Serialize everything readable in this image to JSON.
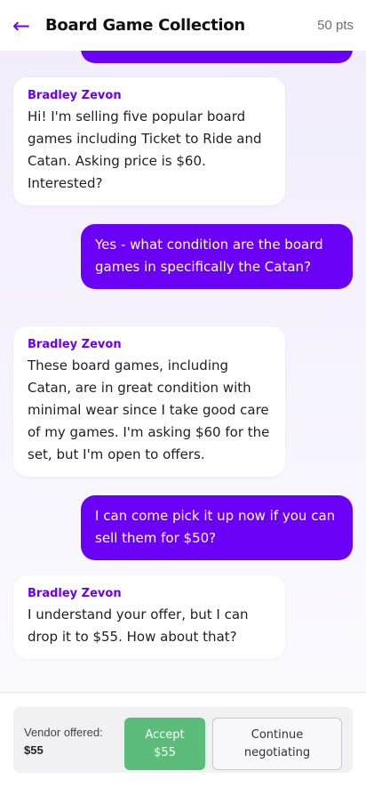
{
  "header": {
    "back_icon": "←",
    "title": "Board Game Collection",
    "points": "50 pts"
  },
  "messages": [
    {
      "from": "me",
      "text": ""
    },
    {
      "from": "vendor",
      "sender": "Bradley Zevon",
      "text": "Hi! I'm selling five popular board games including Ticket to Ride and Catan. Asking price is $60. Interested?"
    },
    {
      "from": "me",
      "text": "Yes - what condition are the board games in specifically the Catan?"
    },
    {
      "from": "vendor",
      "sender": "Bradley Zevon",
      "text": "These board games, including Catan, are in great condition with minimal wear since I take good care of my games. I'm asking $60 for the set, but I'm open to offers."
    },
    {
      "from": "me",
      "text": "I can come pick it up now if you can sell them for $50?"
    },
    {
      "from": "vendor",
      "sender": "Bradley Zevon",
      "text": "I understand your offer, but I can drop it to $55. How about that?"
    }
  ],
  "offer": {
    "label": "Vendor offered:",
    "amount": "$55",
    "accept_label": "Accept",
    "accept_amount": "$55",
    "continue_line1": "Continue",
    "continue_line2": "negotiating"
  },
  "colors": {
    "accent": "#6b00f6",
    "accept": "#5bbd79"
  }
}
